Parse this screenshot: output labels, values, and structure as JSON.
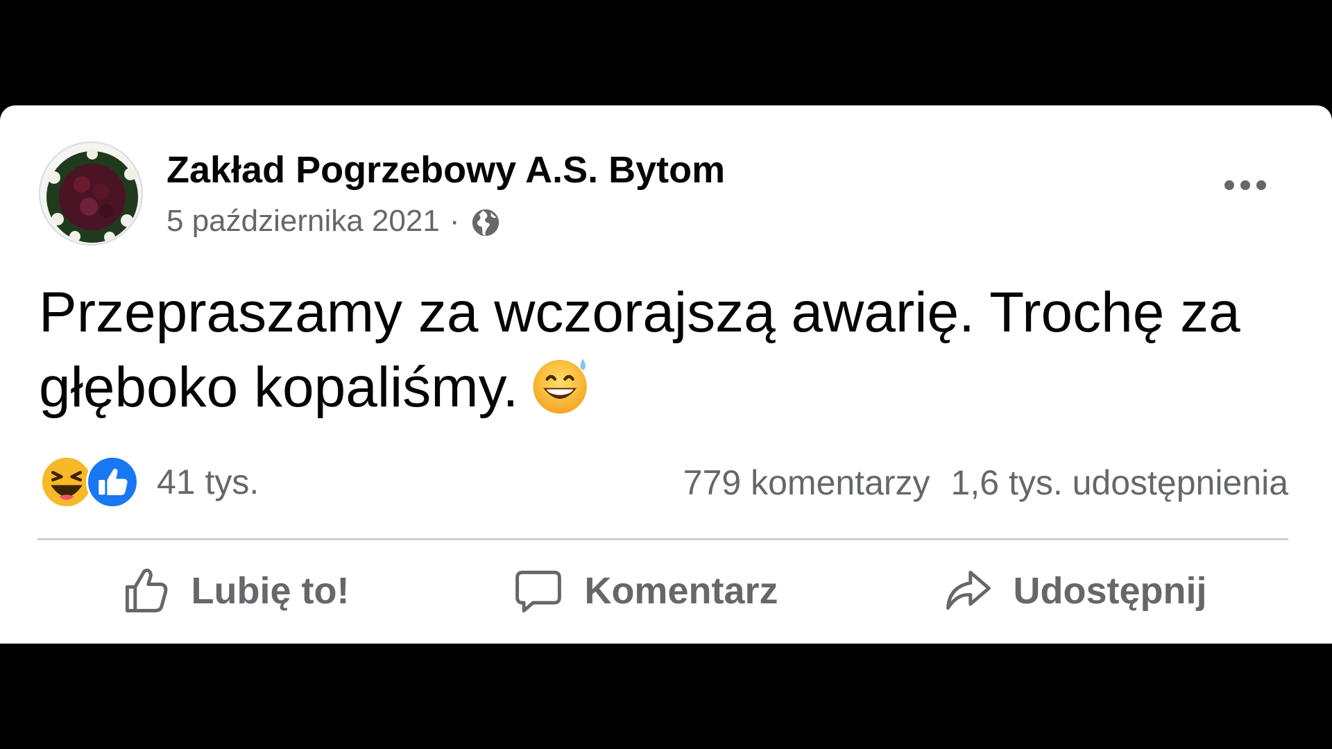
{
  "post": {
    "author": "Zakład Pogrzebowy A.S. Bytom",
    "date": "5 października 2021",
    "separator": "·",
    "privacy_icon": "globe-icon",
    "text": "Przepraszamy za wczorajszą awarię. Trochę za głęboko kopaliśmy.",
    "text_emoji": "grinning-sweat-emoji"
  },
  "reactions": {
    "icons": [
      "haha-reaction-icon",
      "like-reaction-icon"
    ],
    "count": "41 tys."
  },
  "stats": {
    "comments": "779 komentarzy",
    "shares": "1,6 tys. udostępnienia"
  },
  "actions": {
    "like_label": "Lubię to!",
    "comment_label": "Komentarz",
    "share_label": "Udostępnij"
  },
  "colors": {
    "background": "#000000",
    "card": "#ffffff",
    "text_primary": "#050505",
    "text_secondary": "#65676b",
    "like_blue": "#1877f2",
    "haha_yellow": "#f7b928"
  }
}
